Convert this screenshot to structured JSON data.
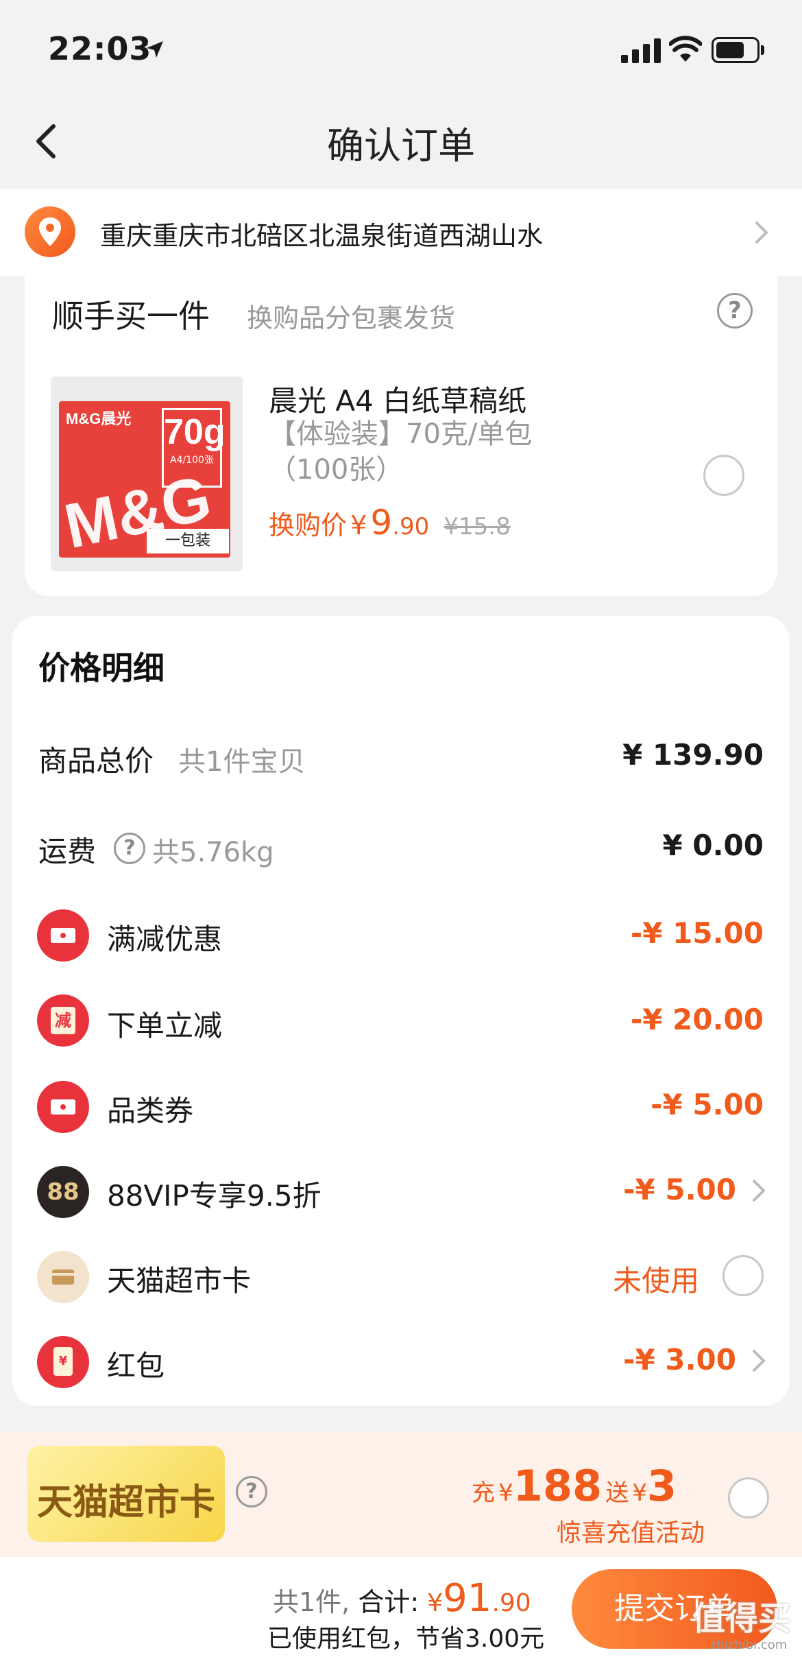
{
  "status_bar": {
    "time": "22:03"
  },
  "nav": {
    "title": "确认订单"
  },
  "address": {
    "text": "重庆重庆市北碚区北温泉街道西湖山水"
  },
  "addon": {
    "title": "顺手买一件",
    "subtitle": "换购品分包裹发货",
    "product": {
      "image_brand": "M&G晨光",
      "image_weight": "70g",
      "image_size": "A4/100张",
      "image_logo": "M&G",
      "image_pack": "一包装",
      "name": "晨光 A4 白纸草稿纸",
      "desc_line1": "【体验装】70克/单包",
      "desc_line2": "（100张）",
      "price_label": "换购价",
      "currency": "¥",
      "price_int": "9",
      "price_dec": ".90",
      "original_price": "¥15.8"
    }
  },
  "details": {
    "title": "价格明细",
    "rows": [
      {
        "label": "商品总价",
        "sub": "共1件宝贝",
        "value": "¥ 139.90"
      },
      {
        "label": "运费",
        "sub": "共5.76kg",
        "value": "¥ 0.00"
      },
      {
        "label": "满减优惠",
        "value": "-¥ 15.00",
        "icon": "coupon-icon"
      },
      {
        "label": "下单立减",
        "value": "-¥ 20.00",
        "icon": "instant-discount-icon",
        "icon_char": "减"
      },
      {
        "label": "品类券",
        "value": "-¥ 5.00",
        "icon": "category-coupon-icon"
      },
      {
        "label": "88VIP专享9.5折",
        "value": "-¥ 5.00",
        "icon": "vip-88-icon",
        "icon_char": "88"
      },
      {
        "label": "天猫超市卡",
        "value": "未使用",
        "icon": "tmall-card-icon"
      },
      {
        "label": "红包",
        "value": "-¥ 3.00",
        "icon": "red-packet-icon",
        "icon_char": "¥"
      }
    ]
  },
  "promo": {
    "badge": "天猫超市卡",
    "recharge_label": "充",
    "recharge_currency": "¥",
    "recharge_amount": "188",
    "bonus_label": "送",
    "bonus_currency": "¥",
    "bonus_amount": "3",
    "note": "惊喜充值活动"
  },
  "bottom": {
    "count": "共1件,",
    "total_label": "合计:",
    "currency": "¥",
    "total_int": "91",
    "total_dec": ".90",
    "saved": "已使用红包，节省3.00元",
    "submit": "提交订单"
  },
  "watermark": {
    "text": "值得买",
    "url": "zhizhibi.com"
  },
  "colors": {
    "accent": "#f05a1a",
    "brand_gradient_start": "#ff8a3d",
    "brand_gradient_end": "#f25a1e"
  }
}
